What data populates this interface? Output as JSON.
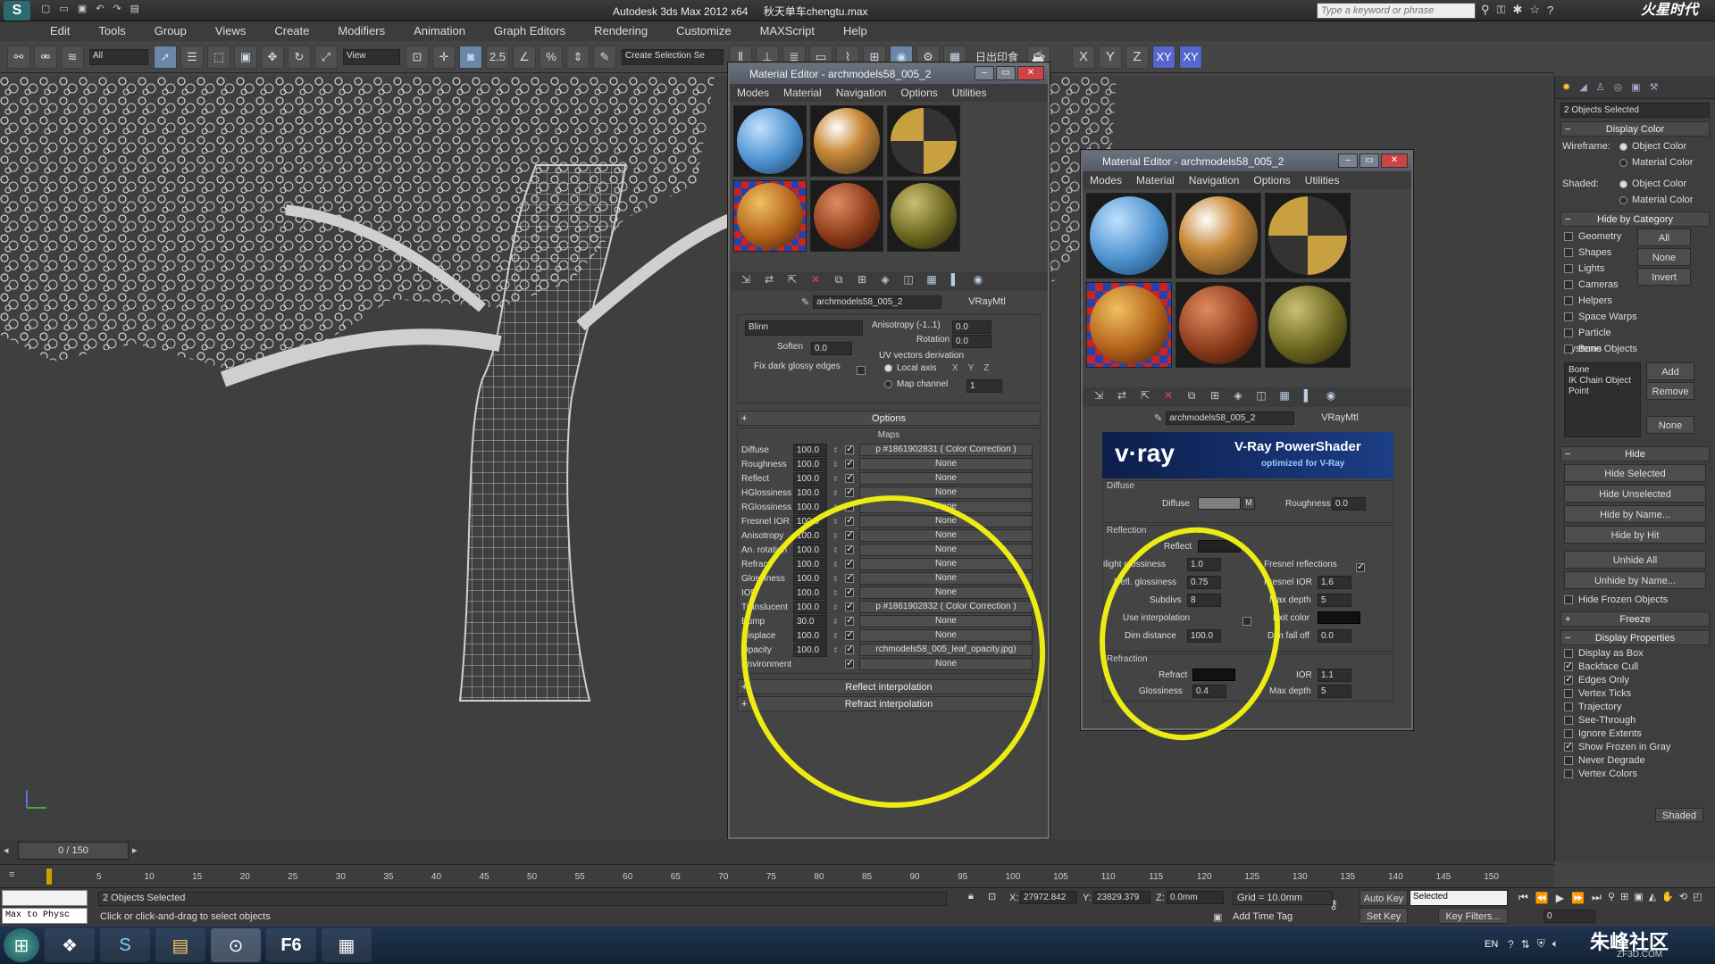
{
  "app": {
    "title": "Autodesk 3ds Max  2012 x64",
    "file": "秋天单车chengtu.max",
    "search_placeholder": "Type a keyword or phrase",
    "logo": "S",
    "watermark_logo": "火星时代"
  },
  "menu": [
    "Edit",
    "Tools",
    "Group",
    "Views",
    "Create",
    "Modifiers",
    "Animation",
    "Graph Editors",
    "Rendering",
    "Customize",
    "MAXScript",
    "Help"
  ],
  "toolbar": {
    "filter": "All",
    "refcoord": "View",
    "snap_num": "2.5",
    "named_sel": "Create Selection Se",
    "axes": [
      "X",
      "Y",
      "Z",
      "XY",
      "XY"
    ],
    "chinese_label": "日出印食"
  },
  "me1": {
    "title": "Material Editor - archmodels58_005_2",
    "menu": [
      "Modes",
      "Material",
      "Navigation",
      "Options",
      "Utilities"
    ],
    "mat_name": "archmodels58_005_2",
    "mat_type": "VRayMtl",
    "brdf": "Blinn",
    "soften_label": "Soften",
    "soften": "0.0",
    "fix_label": "Fix dark glossy edges",
    "anisotropy_label": "Anisotropy (-1..1)",
    "anisotropy": "0.0",
    "rotation_label": "Rotation",
    "rotation": "0.0",
    "uv_label": "UV vectors derivation",
    "local_axis": "Local axis",
    "map_channel_label": "Map channel",
    "map_channel": "1",
    "options_label": "Options",
    "maps_label": "Maps",
    "maps": [
      {
        "label": "Diffuse",
        "amount": "100.0",
        "map": "p #1861902831  ( Color Correction )"
      },
      {
        "label": "Roughness",
        "amount": "100.0",
        "map": "None"
      },
      {
        "label": "Reflect",
        "amount": "100.0",
        "map": "None"
      },
      {
        "label": "HGlossiness",
        "amount": "100.0",
        "map": "None"
      },
      {
        "label": "RGlossiness",
        "amount": "100.0",
        "map": "None"
      },
      {
        "label": "Fresnel IOR",
        "amount": "100.0",
        "map": "None"
      },
      {
        "label": "Anisotropy",
        "amount": "100.0",
        "map": "None"
      },
      {
        "label": "An. rotation",
        "amount": "100.0",
        "map": "None"
      },
      {
        "label": "Refract",
        "amount": "100.0",
        "map": "None"
      },
      {
        "label": "Glossiness",
        "amount": "100.0",
        "map": "None"
      },
      {
        "label": "IOR",
        "amount": "100.0",
        "map": "None"
      },
      {
        "label": "Translucent",
        "amount": "100.0",
        "map": "p #1861902832  ( Color Correction )"
      },
      {
        "label": "Bump",
        "amount": "30.0",
        "map": "None"
      },
      {
        "label": "Displace",
        "amount": "100.0",
        "map": "None"
      },
      {
        "label": "Opacity",
        "amount": "100.0",
        "map": "rchmodels58_005_leaf_opacity.jpg)"
      },
      {
        "label": "Environment",
        "amount": "",
        "map": "None"
      }
    ],
    "reflect_interp": "Reflect interpolation",
    "refract_interp": "Refract interpolation"
  },
  "me2": {
    "title": "Material Editor - archmodels58_005_2",
    "menu": [
      "Modes",
      "Material",
      "Navigation",
      "Options",
      "Utilities"
    ],
    "mat_name": "archmodels58_005_2",
    "mat_type": "VRayMtl",
    "banner_logo": "v·ray",
    "banner_title": "V-Ray PowerShader",
    "banner_sub": "optimized for V-Ray",
    "diffuse_group": "Diffuse",
    "diffuse_label": "Diffuse",
    "roughness_label": "Roughness",
    "roughness": "0.0",
    "reflection_group": "Reflection",
    "reflect_label": "Reflect",
    "hilight_label": "ilight glossiness",
    "hilight": "1.0",
    "fresnel_label": "Fresnel reflections",
    "refl_gloss_label": "Refl. glossiness",
    "refl_gloss": "0.75",
    "fresnel_ior_label": "Fresnel IOR",
    "fresnel_ior": "1.6",
    "subdivs_label": "Subdivs",
    "subdivs": "8",
    "max_depth_label": "Max depth",
    "max_depth": "5",
    "use_interp_label": "Use interpolation",
    "exit_color_label": "Exit color",
    "dim_dist_label": "Dim distance",
    "dim_dist": "100.0",
    "dim_falloff_label": "Dim fall off",
    "dim_falloff": "0.0",
    "refraction_group": "Refraction",
    "refract_label": "Refract",
    "ior_label": "IOR",
    "ior": "1.1",
    "glossiness_label": "Glossiness",
    "glossiness": "0.4",
    "max_depth2_label": "Max depth",
    "max_depth2": "5"
  },
  "cmd": {
    "selected": "2 Objects Selected",
    "display_color": "Display Color",
    "wireframe_label": "Wireframe:",
    "shaded_label": "Shaded:",
    "object_color": "Object Color",
    "material_color": "Material Color",
    "hide_by_category": "Hide by Category",
    "categories": [
      "Geometry",
      "Shapes",
      "Lights",
      "Cameras",
      "Helpers",
      "Space Warps",
      "Particle Systems",
      "Bone Objects"
    ],
    "cat_buttons": [
      "All",
      "None",
      "Invert"
    ],
    "list_items": [
      "Bone",
      "IK Chain Object",
      "Point"
    ],
    "add": "Add",
    "remove": "Remove",
    "none": "None",
    "hide": "Hide",
    "hide_buttons": [
      "Hide Selected",
      "Hide Unselected",
      "Hide by Name...",
      "Hide by Hit",
      "Unhide All",
      "Unhide by Name..."
    ],
    "hide_frozen": "Hide Frozen Objects",
    "freeze": "Freeze",
    "display_properties": "Display Properties",
    "props": [
      {
        "label": "Display as Box",
        "on": false
      },
      {
        "label": "Backface Cull",
        "on": true
      },
      {
        "label": "Edges Only",
        "on": true
      },
      {
        "label": "Vertex Ticks",
        "on": false
      },
      {
        "label": "Trajectory",
        "on": false
      },
      {
        "label": "See-Through",
        "on": false
      },
      {
        "label": "Ignore Extents",
        "on": false
      },
      {
        "label": "Show Frozen in Gray",
        "on": true
      },
      {
        "label": "Never Degrade",
        "on": false
      },
      {
        "label": "Vertex Colors",
        "on": false
      }
    ],
    "shaded_btn": "Shaded"
  },
  "timeline": {
    "frame": "0 / 150",
    "ticks": [
      "5",
      "10",
      "15",
      "20",
      "25",
      "30",
      "35",
      "40",
      "45",
      "50",
      "55",
      "60",
      "65",
      "70",
      "75",
      "80",
      "85",
      "90",
      "95",
      "100",
      "105",
      "110",
      "115",
      "120",
      "125",
      "130",
      "135",
      "140",
      "145",
      "150"
    ]
  },
  "status": {
    "script": "Max to Physc",
    "selected": "2 Objects Selected",
    "prompt": "Click or click-and-drag to select objects",
    "x_label": "X:",
    "x": "27972.842",
    "y_label": "Y:",
    "y": "23829.379",
    "z_label": "Z:",
    "z": "0.0mm",
    "grid": "Grid = 10.0mm",
    "add_time_tag": "Add Time Tag",
    "auto_key": "Auto Key",
    "set_key": "Set Key",
    "key_mode": "Selected",
    "key_filters": "Key Filters...",
    "frame_field": "0"
  },
  "taskbar": {
    "items": [
      "⊞",
      "❖",
      "S",
      "▤",
      "⊙",
      "F6",
      "▦"
    ],
    "tray": "EN",
    "brand": "朱峰社区",
    "brand_sub": "ZF3D.COM"
  }
}
